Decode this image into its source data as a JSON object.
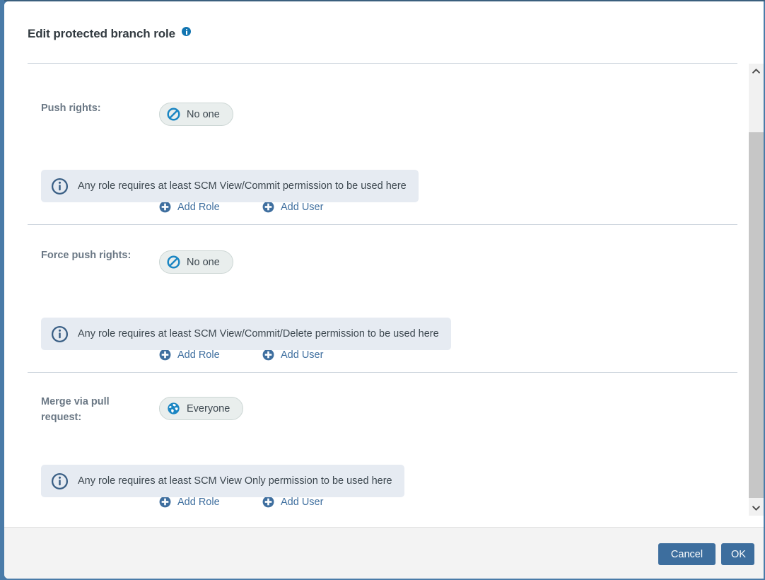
{
  "dialog": {
    "title": "Edit protected branch role",
    "title_info_icon": "info-icon"
  },
  "sections": [
    {
      "label": "Push rights:",
      "chip": {
        "icon": "no-entry-icon",
        "label": "No one"
      },
      "add_role": "Add Role",
      "add_user": "Add User",
      "banner": {
        "icon": "info-circle-icon",
        "text": "Any role requires at least SCM View/Commit permission to be used here"
      }
    },
    {
      "label": "Force push rights:",
      "chip": {
        "icon": "no-entry-icon",
        "label": "No one"
      },
      "add_role": "Add Role",
      "add_user": "Add User",
      "banner": {
        "icon": "info-circle-icon",
        "text": "Any role requires at least SCM View/Commit/Delete permission to be used here"
      }
    },
    {
      "label": "Merge via pull request:",
      "chip": {
        "icon": "globe-icon",
        "label": "Everyone"
      },
      "add_role": "Add Role",
      "add_user": "Add User",
      "banner": {
        "icon": "info-circle-icon",
        "text": "Any role requires at least SCM View Only permission to be used here"
      }
    }
  ],
  "scrollbar": {
    "up_icon": "chevron-up-icon",
    "down_icon": "chevron-down-icon"
  },
  "footer": {
    "cancel_label": "Cancel",
    "ok_label": "OK"
  },
  "colors": {
    "accent_blue": "#1275b1",
    "button_blue": "#3d6e9e",
    "link_blue": "#3f6f9f",
    "banner_bg": "#e6ebf2",
    "chip_bg": "#e9eeed",
    "label_gray": "#6b7885",
    "backdrop": "#4a7ba8"
  }
}
